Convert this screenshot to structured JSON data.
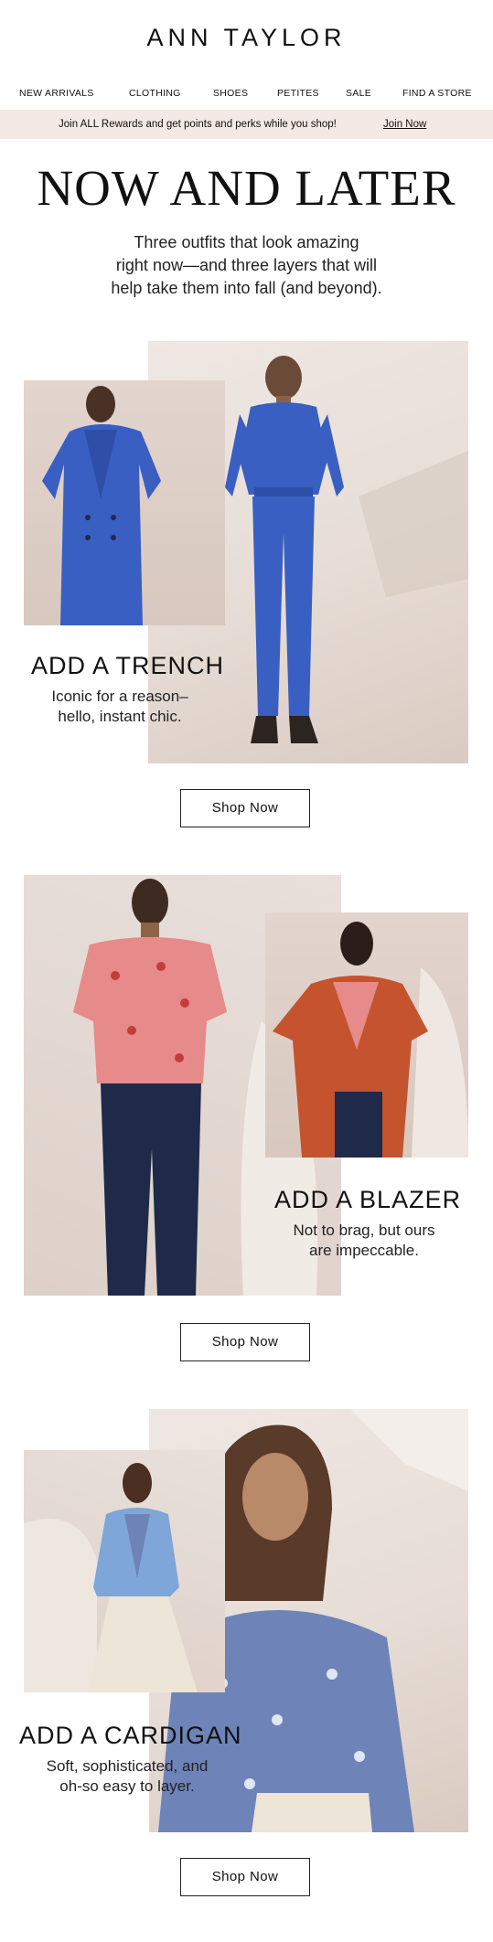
{
  "brand": {
    "logo_text": "ANN TAYLOR"
  },
  "nav": {
    "items": [
      {
        "label": "NEW ARRIVALS"
      },
      {
        "label": "CLOTHING"
      },
      {
        "label": "SHOES"
      },
      {
        "label": "PETITES"
      },
      {
        "label": "SALE"
      },
      {
        "label": "FIND A STORE"
      }
    ]
  },
  "banner": {
    "text": "Join ALL Rewards and get points and perks while you shop!",
    "link_label": "Join Now",
    "background": "#f5e9e6"
  },
  "hero": {
    "headline": "NOW AND LATER",
    "intro_lines": [
      "Three outfits that look amazing",
      "right now—and three layers that will",
      "help take them into fall (and beyond)."
    ]
  },
  "sections": [
    {
      "title": "ADD A TRENCH",
      "subtitle_lines": [
        "Iconic for a reason–",
        "hello, instant chic."
      ],
      "button_label": "Shop Now",
      "garment_colors": {
        "primary": "#3a5fc2",
        "secondary": "#3a5fc2"
      }
    },
    {
      "title": "ADD A BLAZER",
      "subtitle_lines": [
        "Not to brag, but ours",
        "are impeccable."
      ],
      "button_label": "Shop Now",
      "garment_colors": {
        "primary": "#e68a8a",
        "secondary": "#c4532e"
      }
    },
    {
      "title": "ADD A CARDIGAN",
      "subtitle_lines": [
        "Soft, sophisticated, and",
        "oh-so easy to layer."
      ],
      "button_label": "Shop Now",
      "garment_colors": {
        "primary": "#7fa6d8",
        "secondary": "#6e83b8"
      }
    }
  ]
}
